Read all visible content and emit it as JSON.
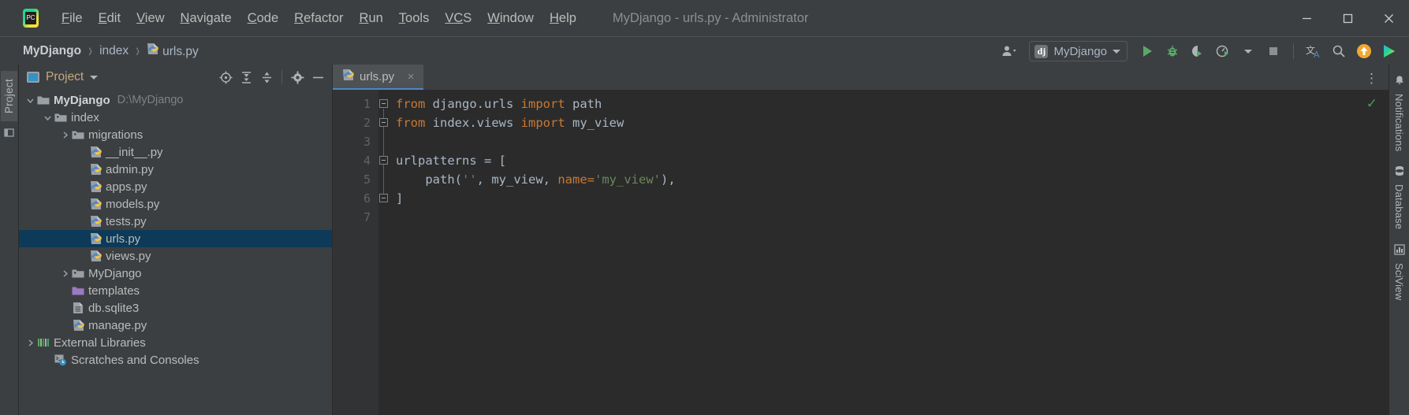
{
  "window": {
    "title": "MyDjango - urls.py - Administrator",
    "app_icon": "pycharm-logo-icon",
    "controls": [
      {
        "name": "minimize-button",
        "glyph": "minimize-icon"
      },
      {
        "name": "maximize-button",
        "glyph": "maximize-icon"
      },
      {
        "name": "close-button",
        "glyph": "close-icon"
      }
    ]
  },
  "menubar": {
    "items": [
      {
        "label": "File",
        "mnemonic": "F",
        "rest": "ile"
      },
      {
        "label": "Edit",
        "mnemonic": "E",
        "rest": "dit"
      },
      {
        "label": "View",
        "mnemonic": "V",
        "rest": "iew"
      },
      {
        "label": "Navigate",
        "mnemonic": "N",
        "rest": "avigate"
      },
      {
        "label": "Code",
        "mnemonic": "C",
        "rest": "ode"
      },
      {
        "label": "Refactor",
        "mnemonic": "R",
        "rest": "efactor"
      },
      {
        "label": "Run",
        "mnemonic": "R",
        "rest": "un"
      },
      {
        "label": "Tools",
        "mnemonic": "T",
        "rest": "ools"
      },
      {
        "label": "VCS",
        "mnemonic": "VC",
        "rest": "S"
      },
      {
        "label": "Window",
        "mnemonic": "W",
        "rest": "indow"
      },
      {
        "label": "Help",
        "mnemonic": "H",
        "rest": "elp"
      }
    ]
  },
  "navbar": {
    "breadcrumbs": [
      {
        "label": "MyDjango",
        "icon": null
      },
      {
        "label": "index",
        "icon": null
      },
      {
        "label": "urls.py",
        "icon": "python-file-icon"
      }
    ],
    "separator": "›",
    "run_config": {
      "label": "MyDjango",
      "icon": "django-icon",
      "icon_text": "dj"
    },
    "buttons": [
      {
        "name": "settings-sync-icon",
        "glyph": "person"
      },
      {
        "name": "run-button",
        "glyph": "play"
      },
      {
        "name": "debug-button",
        "glyph": "bug"
      },
      {
        "name": "run-with-coverage-button",
        "glyph": "coverage"
      },
      {
        "name": "profile-button",
        "glyph": "profiler"
      },
      {
        "name": "stop-button",
        "glyph": "stop"
      },
      {
        "name": "translate-icon",
        "glyph": "translate"
      },
      {
        "name": "search-everywhere-icon",
        "glyph": "search"
      },
      {
        "name": "update-available-icon",
        "glyph": "arrow-up"
      },
      {
        "name": "toolbox-icon",
        "glyph": "toolbox"
      }
    ]
  },
  "left_strip": {
    "tabs": [
      {
        "label": "Project",
        "active": true
      }
    ],
    "bottom_icon": "structure-icon"
  },
  "project_panel": {
    "title": "Project",
    "actions": [
      {
        "name": "select-opened-file-icon"
      },
      {
        "name": "expand-all-icon"
      },
      {
        "name": "collapse-all-icon"
      },
      {
        "name": "settings-gear-icon"
      },
      {
        "name": "hide-panel-icon"
      }
    ],
    "tree": [
      {
        "label": "MyDjango",
        "path": "D:\\MyDjango",
        "icon": "folder-module-icon",
        "indent": 0,
        "twist": "down",
        "bold": true,
        "selected": false
      },
      {
        "label": "index",
        "path": "",
        "icon": "folder-source-icon",
        "indent": 1,
        "twist": "down",
        "bold": false,
        "selected": false
      },
      {
        "label": "migrations",
        "path": "",
        "icon": "folder-source-icon",
        "indent": 2,
        "twist": "right",
        "bold": false,
        "selected": false
      },
      {
        "label": "__init__.py",
        "path": "",
        "icon": "python-file-icon",
        "indent": 3,
        "twist": "",
        "bold": false,
        "selected": false
      },
      {
        "label": "admin.py",
        "path": "",
        "icon": "python-file-icon",
        "indent": 3,
        "twist": "",
        "bold": false,
        "selected": false
      },
      {
        "label": "apps.py",
        "path": "",
        "icon": "python-file-icon",
        "indent": 3,
        "twist": "",
        "bold": false,
        "selected": false
      },
      {
        "label": "models.py",
        "path": "",
        "icon": "python-file-icon",
        "indent": 3,
        "twist": "",
        "bold": false,
        "selected": false
      },
      {
        "label": "tests.py",
        "path": "",
        "icon": "python-file-icon",
        "indent": 3,
        "twist": "",
        "bold": false,
        "selected": false
      },
      {
        "label": "urls.py",
        "path": "",
        "icon": "python-file-icon",
        "indent": 3,
        "twist": "",
        "bold": false,
        "selected": true
      },
      {
        "label": "views.py",
        "path": "",
        "icon": "python-file-icon",
        "indent": 3,
        "twist": "",
        "bold": false,
        "selected": false
      },
      {
        "label": "MyDjango",
        "path": "",
        "icon": "folder-source-icon",
        "indent": 2,
        "twist": "right",
        "bold": false,
        "selected": false
      },
      {
        "label": "templates",
        "path": "",
        "icon": "folder-template-icon",
        "indent": 2,
        "twist": "",
        "bold": false,
        "selected": false
      },
      {
        "label": "db.sqlite3",
        "path": "",
        "icon": "database-file-icon",
        "indent": 2,
        "twist": "",
        "bold": false,
        "selected": false
      },
      {
        "label": "manage.py",
        "path": "",
        "icon": "python-file-icon",
        "indent": 2,
        "twist": "",
        "bold": false,
        "selected": false
      },
      {
        "label": "External Libraries",
        "path": "",
        "icon": "libraries-icon",
        "indent": 0,
        "twist": "right",
        "bold": false,
        "selected": false
      },
      {
        "label": "Scratches and Consoles",
        "path": "",
        "icon": "scratches-icon",
        "indent": 1,
        "twist": "",
        "bold": false,
        "selected": false
      }
    ]
  },
  "editor": {
    "tabs": [
      {
        "label": "urls.py",
        "icon": "python-file-icon",
        "active": true,
        "close": "×"
      }
    ],
    "options_icon": "more-options-icon",
    "inspection_status": "✓",
    "line_numbers": [
      "1",
      "2",
      "3",
      "4",
      "5",
      "6",
      "7"
    ],
    "lines": [
      [
        {
          "t": "from ",
          "c": "kw"
        },
        {
          "t": "django.urls ",
          "c": "id"
        },
        {
          "t": "import ",
          "c": "kw"
        },
        {
          "t": "path",
          "c": "id"
        }
      ],
      [
        {
          "t": "from ",
          "c": "kw"
        },
        {
          "t": "index.views ",
          "c": "id"
        },
        {
          "t": "import ",
          "c": "kw"
        },
        {
          "t": "my_view",
          "c": "id"
        }
      ],
      [],
      [
        {
          "t": "urlpatterns = [",
          "c": "id"
        }
      ],
      [
        {
          "t": "    path(",
          "c": "id"
        },
        {
          "t": "''",
          "c": "str"
        },
        {
          "t": ", my_view, ",
          "c": "id"
        },
        {
          "t": "name=",
          "c": "named"
        },
        {
          "t": "'my_view'",
          "c": "str"
        },
        {
          "t": "),",
          "c": "id"
        }
      ],
      [
        {
          "t": "]",
          "c": "id"
        }
      ],
      []
    ]
  },
  "right_strip": {
    "tabs": [
      {
        "label": "Notifications",
        "icon": "bell-icon"
      },
      {
        "label": "Database",
        "icon": "database-icon"
      },
      {
        "label": "SciView",
        "icon": "sciview-icon"
      }
    ]
  },
  "colors": {
    "accent": "#4a88c7",
    "selection": "#0d3a58",
    "keyword": "#cc7832",
    "string": "#6a8759",
    "identifier": "#a9b7c6",
    "panel_bg": "#3c3f41",
    "editor_bg": "#2b2b2b",
    "ok_green": "#499c54"
  }
}
